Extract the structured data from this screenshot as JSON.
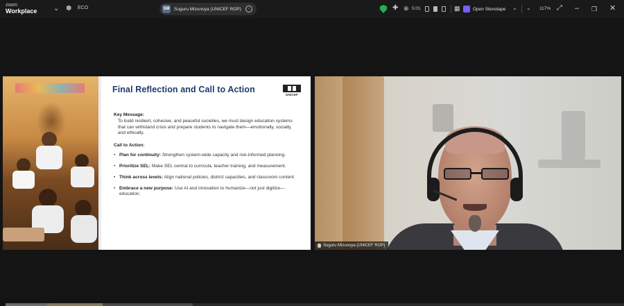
{
  "titlebar": {
    "brand_top": "zoom",
    "brand_bottom": "Workplace",
    "eco_label": "ECO",
    "active_speaker": {
      "initials": "SM",
      "name": "Suguru Mizunoya (UNICEF ROP)"
    },
    "status_text": "5:01",
    "open_steno_label": "Open Stenotape",
    "zoom_level": "117%"
  },
  "slide": {
    "title": "Final Reflection and Call to Action",
    "logo_text": "UNICEF",
    "key_message_heading": "Key Message:",
    "key_message_body": "To build resilient, cohesive, and peaceful societies, we must design education systems that can withstand crisis and prepare students to navigate them—emotionally, socially, and ethically.",
    "cta_heading": "Call to Action:",
    "cta_items": [
      {
        "bold": "Plan for continuity:",
        "text": " Strengthen system-wide capacity and risk-informed planning."
      },
      {
        "bold": "Prioritize SEL:",
        "text": " Make SEL central to curricula, teacher training, and measurement."
      },
      {
        "bold": "Think across levels:",
        "text": " Align national policies, district capacities, and classroom content."
      },
      {
        "bold": "Embrace a new purpose:",
        "text": " Use AI and innovation to humanize—not just digitize—education."
      }
    ]
  },
  "video": {
    "participant_name": "Suguru Mizunoya (UNICEF ROP)"
  },
  "icons": [
    "paw-icon",
    "shield-icon",
    "puzzle-icon",
    "minimize-icon",
    "maximize-icon",
    "close-icon"
  ],
  "colors": {
    "slide_title": "#1f3a6b",
    "shield_green": "#22b14c",
    "steno_purple": "#7b5cff"
  }
}
